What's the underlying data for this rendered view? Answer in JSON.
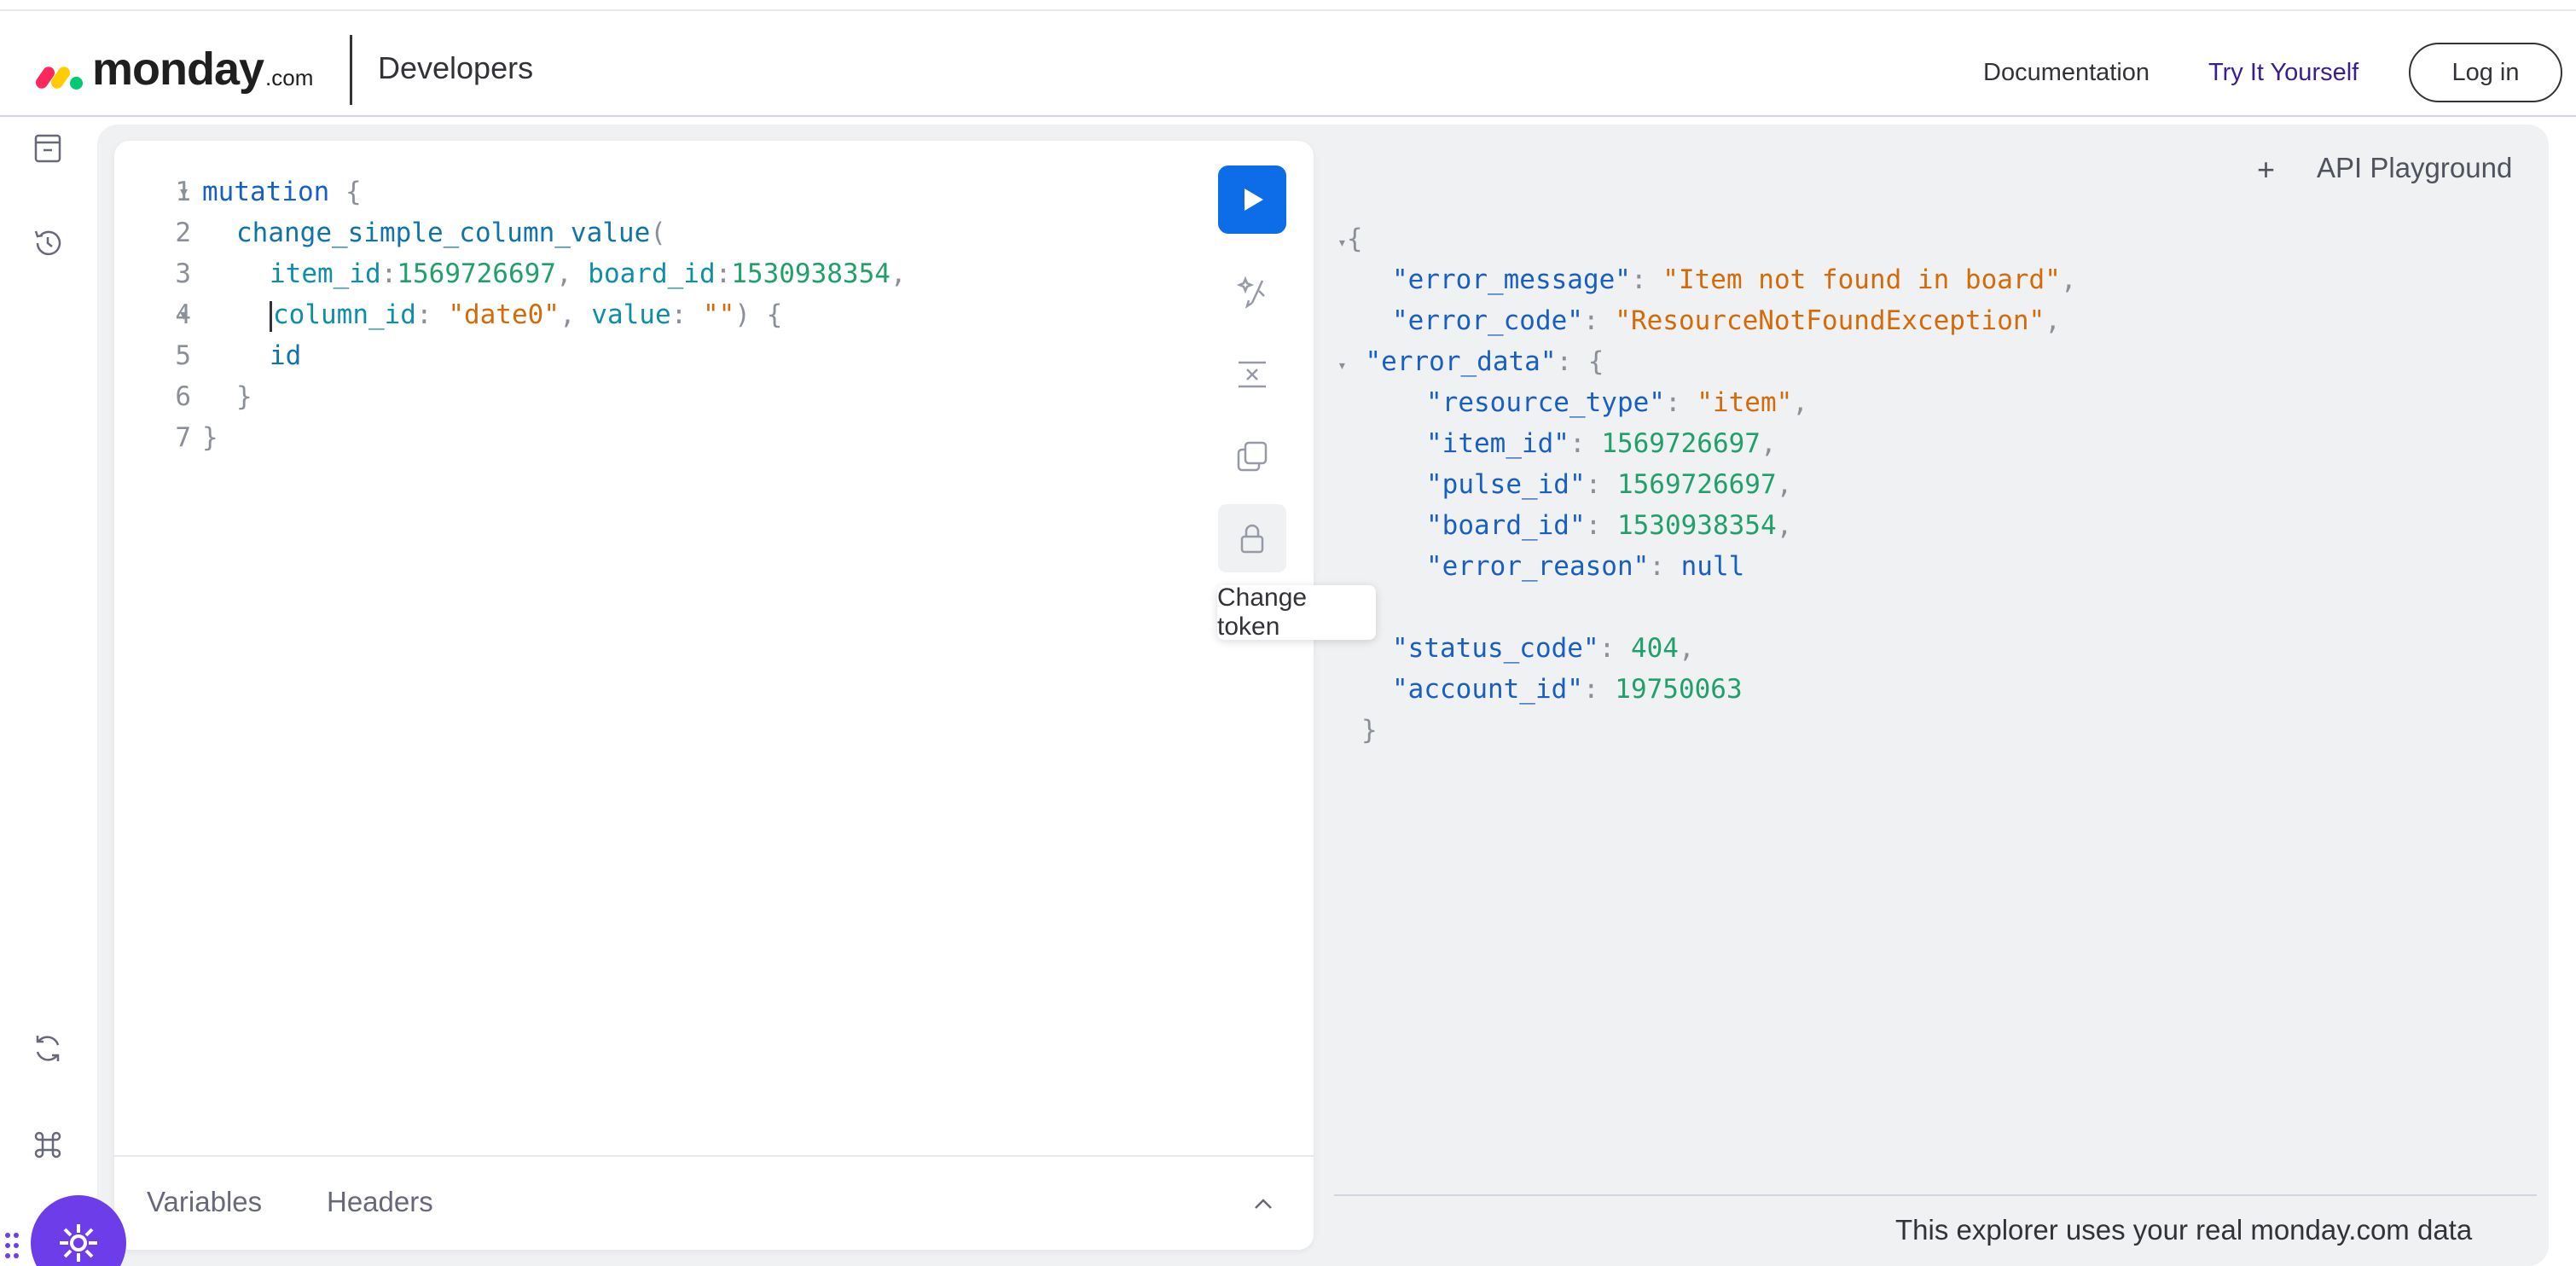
{
  "header": {
    "logo_word": "monday",
    "logo_suffix": ".com",
    "section": "Developers",
    "nav": {
      "documentation": "Documentation",
      "try_it": "Try It Yourself",
      "login": "Log in"
    }
  },
  "editor": {
    "lines": [
      {
        "n": "1",
        "fold": "▾"
      },
      {
        "n": "2",
        "fold": ""
      },
      {
        "n": "3",
        "fold": ""
      },
      {
        "n": "4",
        "fold": "▾"
      },
      {
        "n": "5",
        "fold": ""
      },
      {
        "n": "6",
        "fold": ""
      },
      {
        "n": "7",
        "fold": ""
      }
    ],
    "code": {
      "l1_kw": "mutation",
      "l1_brace": " {",
      "l2_fn": "change_simple_column_value",
      "l2_paren": "(",
      "l3_k1": "item_id",
      "l3_v1": "1569726697",
      "l3_k2": "board_id",
      "l3_v2": "1530938354",
      "l4_k1": "column_id",
      "l4_v1": "\"date0\"",
      "l4_k2": "value",
      "l4_v2": "\"\"",
      "l4_end": ") {",
      "l5": "id",
      "l6": "}",
      "l7": "}"
    },
    "tooltip": "Change token",
    "bottom_tabs": {
      "variables": "Variables",
      "headers": "Headers"
    }
  },
  "response": {
    "title": "API Playground",
    "plus": "+",
    "json": {
      "open": "{",
      "error_message_key": "\"error_message\"",
      "error_message_val": "\"Item not found in board\"",
      "error_code_key": "\"error_code\"",
      "error_code_val": "\"ResourceNotFoundException\"",
      "error_data_key": "\"error_data\"",
      "resource_type_key": "\"resource_type\"",
      "resource_type_val": "\"item\"",
      "item_id_key": "\"item_id\"",
      "item_id_val": "1569726697",
      "pulse_id_key": "\"pulse_id\"",
      "pulse_id_val": "1569726697",
      "board_id_key": "\"board_id\"",
      "board_id_val": "1530938354",
      "error_reason_key": "\"error_reason\"",
      "error_reason_val": "null",
      "status_code_key": "\"status_code\"",
      "status_code_val": "404",
      "account_id_key": "\"account_id\"",
      "account_id_val": "19750063",
      "close": "}"
    },
    "footer": "This explorer uses your real monday.com data"
  },
  "colors": {
    "run_button": "#0d6ce8",
    "brand_purple": "#6c3de8",
    "try_link": "#3b1d92",
    "string": "#d46b08",
    "number": "#22a06b",
    "key": "#1760c2"
  },
  "icons": {
    "rail": [
      "docs-icon",
      "history-icon",
      "refresh-icon",
      "command-icon"
    ],
    "tools": [
      "prettify-icon",
      "merge-fragments-icon",
      "copy-icon",
      "lock-icon"
    ]
  }
}
